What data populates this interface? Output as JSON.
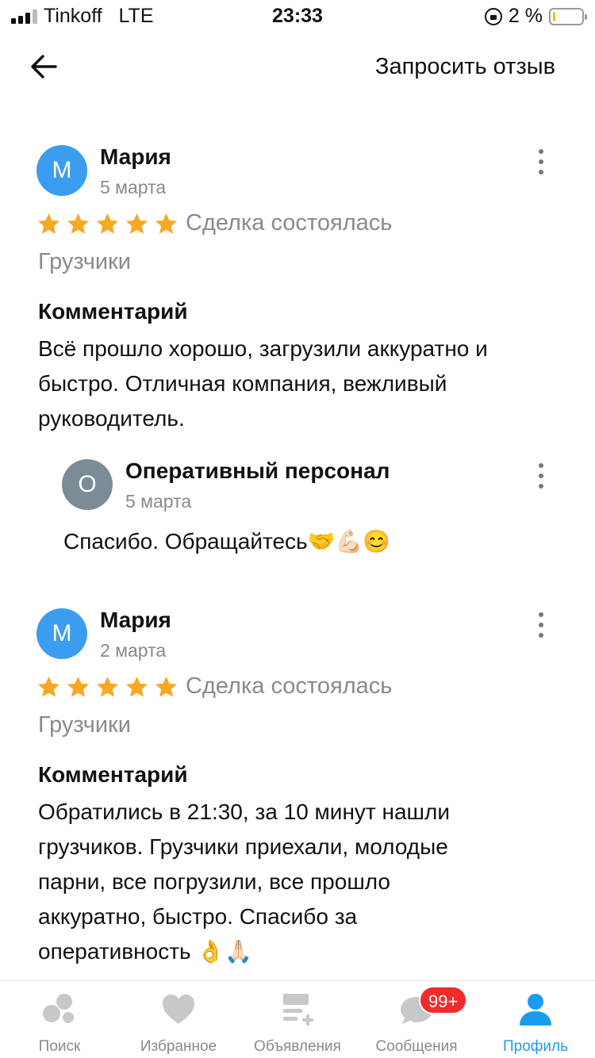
{
  "status_bar": {
    "carrier": "Tinkoff",
    "network": "LTE",
    "time": "23:33",
    "battery_percent": "2 %",
    "battery_level": 0.02
  },
  "header": {
    "back_icon": "arrow-left-icon",
    "action_label": "Запросить отзыв"
  },
  "reviews": [
    {
      "avatar_letter": "М",
      "author": "Мария",
      "date": "5 марта",
      "rating": 5,
      "deal_status": "Сделка состоялась",
      "category": "Грузчики",
      "comment_heading": "Комментарий",
      "comment_lines": [
        "Всё прошло хорошо, загрузили аккуратно и",
        "быстро. Отличная компания, вежливый",
        "руководитель."
      ],
      "reply": {
        "avatar_letter": "О",
        "author": "Оперативный персонал",
        "date": "5 марта",
        "text": "Спасибо. Обращайтесь🤝💪🏻😊"
      }
    },
    {
      "avatar_letter": "М",
      "author": "Мария",
      "date": "2 марта",
      "rating": 5,
      "deal_status": "Сделка состоялась",
      "category": "Грузчики",
      "comment_heading": "Комментарий",
      "comment_lines": [
        "Обратились в 21:30, за 10 минут нашли",
        "грузчиков. Грузчики приехали, молодые",
        "парни, все погрузили, все прошло",
        "аккуратно, быстро. Спасибо за",
        "оперативность 👌🙏🏻"
      ]
    }
  ],
  "colors": {
    "star": "#f7a823",
    "accent": "#1a9bf0",
    "avatar_blue": "#3b9df0",
    "avatar_gray": "#7b8c96",
    "badge": "#ef2c2c"
  },
  "bottom_nav": {
    "items": [
      {
        "label": "Поиск",
        "icon": "search-bubbles-icon"
      },
      {
        "label": "Избранное",
        "icon": "heart-icon"
      },
      {
        "label": "Объявления",
        "icon": "listing-add-icon"
      },
      {
        "label": "Сообщения",
        "icon": "chat-icon",
        "badge": "99+"
      },
      {
        "label": "Профиль",
        "icon": "profile-icon",
        "active": true
      }
    ]
  }
}
